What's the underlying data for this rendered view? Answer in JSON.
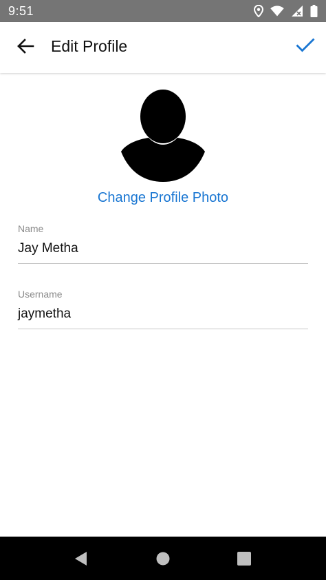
{
  "status_bar": {
    "time": "9:51",
    "icons": [
      "location-icon",
      "wifi-icon",
      "signal-icon",
      "battery-icon"
    ]
  },
  "app_bar": {
    "back_icon": "arrow-left-icon",
    "title": "Edit Profile",
    "done_icon": "checkmark-icon"
  },
  "profile": {
    "avatar_icon": "person-silhouette-icon",
    "change_photo_label": "Change Profile Photo"
  },
  "form": {
    "name": {
      "label": "Name",
      "value": "Jay Metha"
    },
    "username": {
      "label": "Username",
      "value": "jaymetha"
    }
  },
  "nav_bar": {
    "icons": [
      "nav-back-icon",
      "nav-home-icon",
      "nav-recents-icon"
    ]
  },
  "colors": {
    "accent": "#1976d2",
    "status_bar": "#757575",
    "nav_bar": "#000000",
    "divider": "#c6c6c6"
  }
}
